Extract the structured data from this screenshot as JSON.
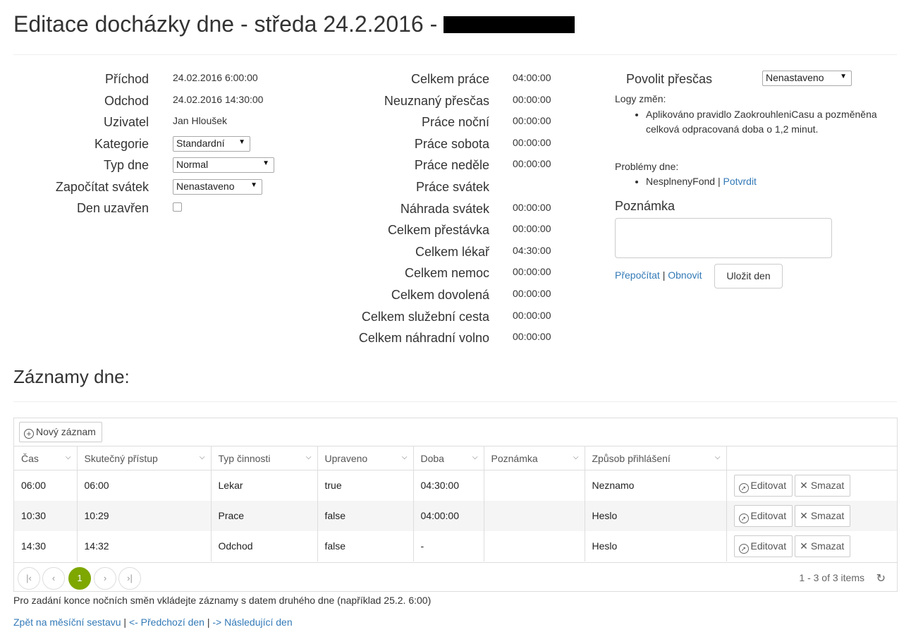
{
  "title": "Editace docházky dne - středa 24.2.2016 - ",
  "left": {
    "prichod_label": "Příchod",
    "prichod_value": "24.02.2016 6:00:00",
    "odchod_label": "Odchod",
    "odchod_value": "24.02.2016 14:30:00",
    "uzivatel_label": "Uzivatel",
    "uzivatel_value": "Jan Hloušek",
    "kategorie_label": "Kategorie",
    "kategorie_value": "Standardní",
    "typ_dne_label": "Typ dne",
    "typ_dne_value": "Normal",
    "svatek_label": "Započítat svátek",
    "svatek_value": "Nenastaveno",
    "uzavren_label": "Den uzavřen"
  },
  "summary": [
    {
      "label": "Celkem práce",
      "value": "04:00:00"
    },
    {
      "label": "Neuznaný přesčas",
      "value": "00:00:00"
    },
    {
      "label": "Práce noční",
      "value": "00:00:00"
    },
    {
      "label": "Práce sobota",
      "value": "00:00:00"
    },
    {
      "label": "Práce neděle",
      "value": "00:00:00"
    },
    {
      "label": "Práce svátek",
      "value": ""
    },
    {
      "label": "Náhrada svátek",
      "value": "00:00:00"
    },
    {
      "label": "Celkem přestávka",
      "value": "00:00:00"
    },
    {
      "label": "Celkem lékař",
      "value": "04:30:00"
    },
    {
      "label": "Celkem nemoc",
      "value": "00:00:00"
    },
    {
      "label": "Celkem dovolená",
      "value": "00:00:00"
    },
    {
      "label": "Celkem služební cesta",
      "value": "00:00:00"
    },
    {
      "label": "Celkem náhradní volno",
      "value": "00:00:00"
    }
  ],
  "right": {
    "prescas_label": "Povolit přesčas",
    "prescas_value": "Nenastaveno",
    "logy_label": "Logy změn:",
    "log_item": "Aplikováno pravidlo ZaokrouhleniCasu a pozměněna celková odpracovaná doba o 1,2 minut.",
    "problemy_label": "Problémy dne:",
    "problem_item": "NesplnenyFond",
    "problem_sep": " | ",
    "potvrdit": "Potvrdit",
    "poznamka_label": "Poznámka",
    "prepocitat": "Přepočítat",
    "sep": " | ",
    "obnovit": "Obnovit",
    "ulozit": "Uložit den"
  },
  "records_title": "Záznamy dne:",
  "grid": {
    "new_button": "Nový záznam",
    "columns": [
      "Čas",
      "Skutečný přístup",
      "Typ činnosti",
      "Upraveno",
      "Doba",
      "Poznámka",
      "Způsob přihlášení",
      ""
    ],
    "rows": [
      [
        "06:00",
        "06:00",
        "Lekar",
        "true",
        "04:30:00",
        "",
        "Neznamo"
      ],
      [
        "10:30",
        "10:29",
        "Prace",
        "false",
        "04:00:00",
        "",
        "Heslo"
      ],
      [
        "14:30",
        "14:32",
        "Odchod",
        "false",
        "-",
        "",
        "Heslo"
      ]
    ],
    "edit_label": "Editovat",
    "delete_label": "Smazat",
    "page": "1",
    "items_info": "1 - 3 of 3 items"
  },
  "note": "Pro zadání konce nočních směn vkládejte záznamy s datem druhého dne (například 25.2. 6:00)",
  "footer": {
    "back": "Zpět na měsíční sestavu",
    "sep1": " | ",
    "prev": "<- Předchozí den",
    "sep2": " | ",
    "next": "-> Následující den"
  }
}
